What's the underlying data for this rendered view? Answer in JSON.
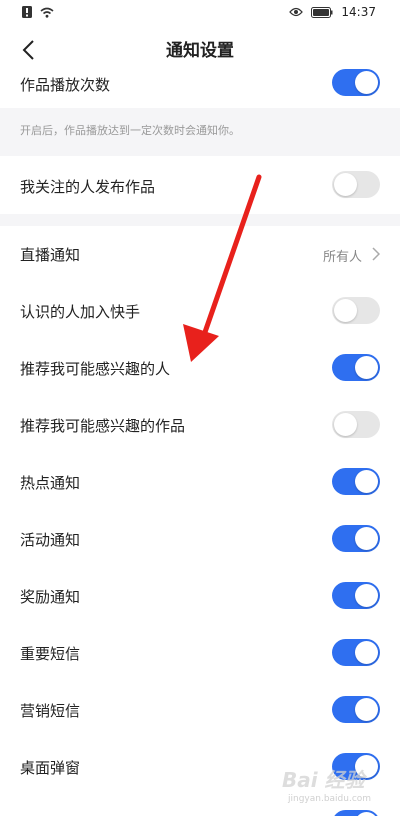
{
  "status_bar": {
    "time": "14:37"
  },
  "nav": {
    "title": "通知设置"
  },
  "top_item": {
    "label": "作品播放次数",
    "on": true,
    "hint": "开启后，作品播放达到一定次数时会通知你。"
  },
  "follow_item": {
    "label": "我关注的人发布作品",
    "on": false
  },
  "live_item": {
    "label": "直播通知",
    "value": "所有人"
  },
  "items": [
    {
      "label": "认识的人加入快手",
      "on": false
    },
    {
      "label": "推荐我可能感兴趣的人",
      "on": true
    },
    {
      "label": "推荐我可能感兴趣的作品",
      "on": false
    },
    {
      "label": "热点通知",
      "on": true
    },
    {
      "label": "活动通知",
      "on": true
    },
    {
      "label": "奖励通知",
      "on": true
    },
    {
      "label": "重要短信",
      "on": true
    },
    {
      "label": "营销短信",
      "on": true
    },
    {
      "label": "桌面弹窗",
      "on": true
    }
  ],
  "watermark": {
    "text": "Bai 经验",
    "sub": "jingyan.baidu.com"
  },
  "colors": {
    "toggle_on": "#2f6ff0",
    "toggle_off": "#e6e6e6",
    "arrow": "#e8211c"
  }
}
